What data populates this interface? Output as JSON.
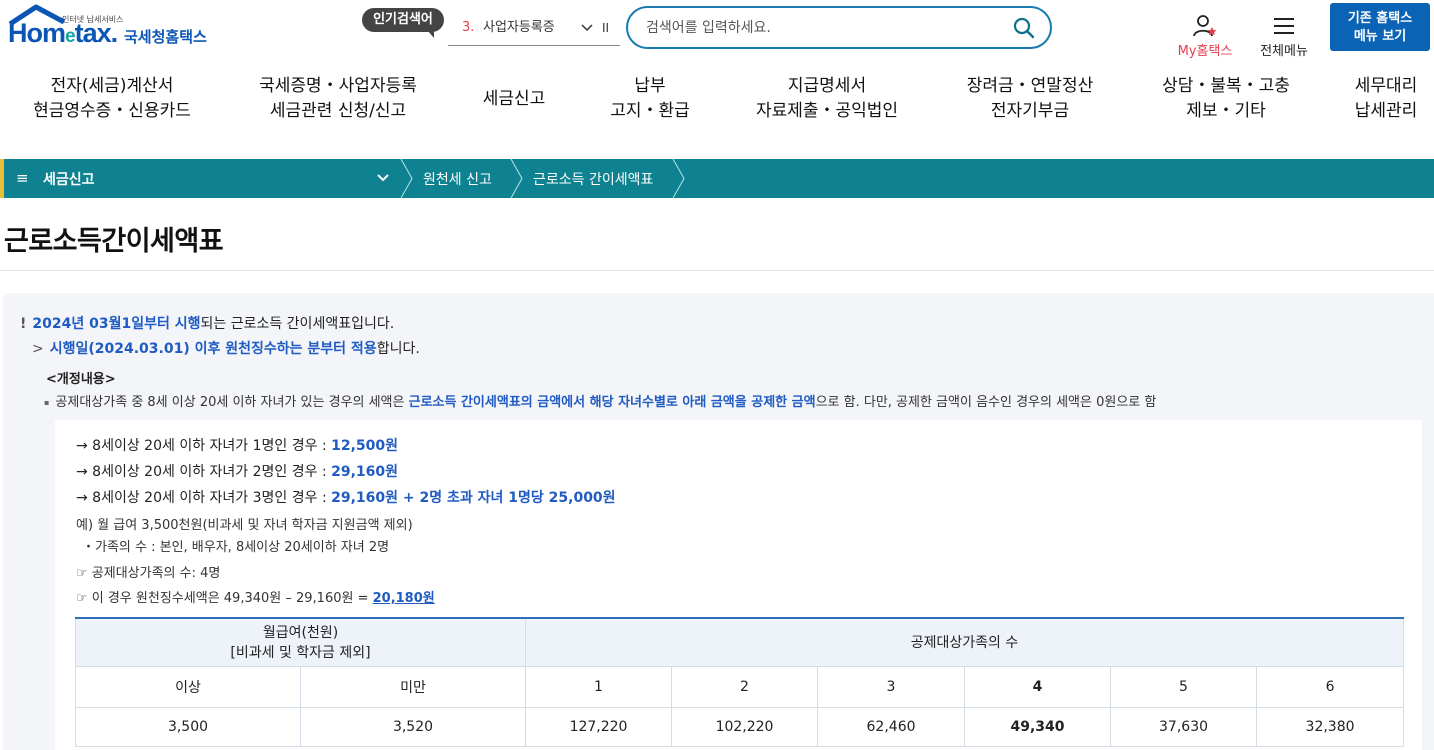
{
  "header": {
    "logo_small": "인터넷 납세서비스",
    "logo_main_prefix": "Hom",
    "logo_main_e": "e",
    "logo_main_suffix": "tax.",
    "logo_sub": "국세청홈택스",
    "popular_badge": "인기검색어",
    "popular_rank": "3.",
    "popular_keyword": "사업자등록증",
    "popular_pause": "II",
    "search_placeholder": "검색어를 입력하세요.",
    "my_label": "My홈택스",
    "all_menu_label": "전체메뉴",
    "legacy_line1": "기존 홈택스",
    "legacy_line2": "메뉴 보기"
  },
  "nav": [
    {
      "line1": "전자(세금)계산서",
      "line2": "현금영수증・신용카드"
    },
    {
      "line1": "국세증명・사업자등록",
      "line2": "세금관련 신청/신고"
    },
    {
      "line1": "세금신고",
      "line2": ""
    },
    {
      "line1": "납부",
      "line2": "고지・환급"
    },
    {
      "line1": "지급명세서",
      "line2": "자료제출・공익법인"
    },
    {
      "line1": "장려금・연말정산",
      "line2": "전자기부금"
    },
    {
      "line1": "상담・불복・고충",
      "line2": "제보・기타"
    },
    {
      "line1": "세무대리",
      "line2": "납세관리"
    }
  ],
  "breadcrumb": {
    "menu_icon": "≡",
    "main": "세금신고",
    "items": [
      "원천세 신고",
      "근로소득 간이세액표"
    ]
  },
  "page_title": "근로소득간이세액표",
  "notice": {
    "bang": "!",
    "highlight": "2024년 03월1일부터 시행",
    "rest": "되는 근로소득 간이세액표입니다.",
    "sub_gt": ">",
    "sub_highlight": "시행일(2024.03.01) 이후 원천징수하는 분부터 적용",
    "sub_rest": "합니다."
  },
  "revision": {
    "title": "<개정내용>",
    "bullet": "▪",
    "text_pre": "공제대상가족 중 8세 이상 20세 이하 자녀가 있는 경우의 세액은 ",
    "text_highlight": "근로소득 간이세액표의 금액에서 해당 자녀수별로 아래 금액을 공제한 금액",
    "text_post": "으로 함. 다만, 공제한 금액이 음수인 경우의 세액은 0원으로 함"
  },
  "deductions": [
    {
      "label": "→ 8세이상 20세 이하 자녀가 1명인 경우 : ",
      "value": "12,500원"
    },
    {
      "label": "→ 8세이상 20세 이하 자녀가 2명인 경우 : ",
      "value": "29,160원"
    },
    {
      "label": "→ 8세이상 20세 이하 자녀가 3명인 경우 : ",
      "value": "29,160원 + 2명 초과 자녀 1명당 25,000원"
    }
  ],
  "example": {
    "line1": "예) 월 급여 3,500천원(비과세 및 자녀 학자금 지원금액 제외)",
    "line2": "・가족의 수 : 본인, 배우자, 8세이상 20세이하 자녀 2명",
    "line3": "☞ 공제대상가족의 수: 4명",
    "line4_pre": "☞ 이 경우 원천징수세액은 49,340원 – 29,160원 = ",
    "line4_link": "20,180원"
  },
  "table": {
    "header_salary_line1": "월급여(천원)",
    "header_salary_line2": "[비과세 및 학자금 제외]",
    "header_family": "공제대상가족의 수",
    "sub_headers": [
      "이상",
      "미만",
      "1",
      "2",
      "3",
      "4",
      "5",
      "6"
    ],
    "rows": [
      [
        "3,500",
        "3,520",
        "127,220",
        "102,220",
        "62,460",
        "49,340",
        "37,630",
        "32,380"
      ]
    ]
  }
}
